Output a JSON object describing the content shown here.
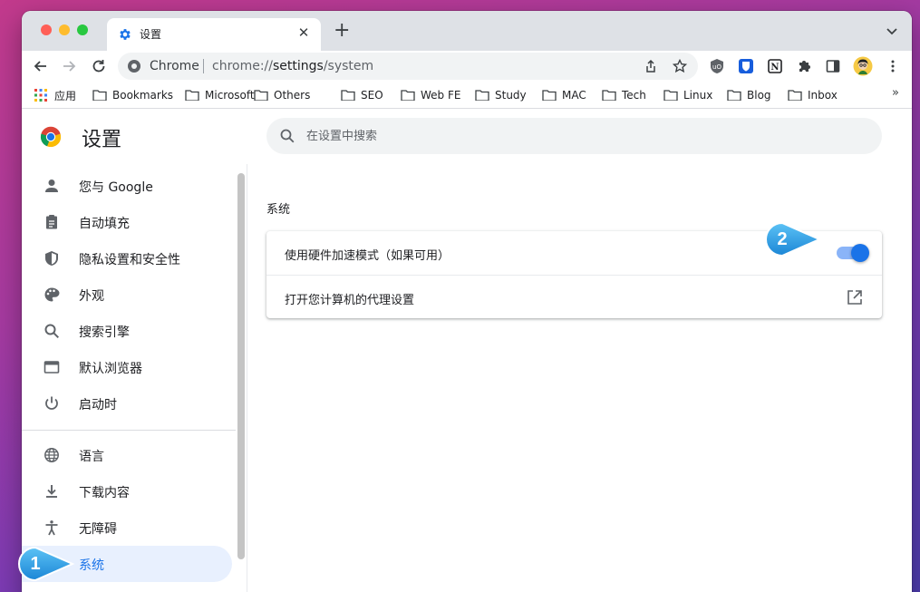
{
  "tab": {
    "title": "设置",
    "close": "✕"
  },
  "toolbar": {
    "omnibox_label": "Chrome",
    "url_prefix": "chrome://",
    "url_bold": "settings",
    "url_suffix": "/system"
  },
  "bookmarks": {
    "apps_label": "应用",
    "items": [
      "Bookmarks",
      "Microsoft",
      "Others",
      "SEO",
      "Web FE",
      "Study",
      "MAC",
      "Tech",
      "Linux",
      "Blog",
      "Inbox"
    ],
    "more": "»"
  },
  "settings": {
    "title": "设置",
    "search_placeholder": "在设置中搜索",
    "sidebar": [
      {
        "label": "您与 Google",
        "icon": "person-icon"
      },
      {
        "label": "自动填充",
        "icon": "clipboard-icon"
      },
      {
        "label": "隐私设置和安全性",
        "icon": "shield-icon"
      },
      {
        "label": "外观",
        "icon": "palette-icon"
      },
      {
        "label": "搜索引擎",
        "icon": "search-icon"
      },
      {
        "label": "默认浏览器",
        "icon": "browser-window-icon"
      },
      {
        "label": "启动时",
        "icon": "power-icon"
      },
      {
        "label": "语言",
        "icon": "globe-icon"
      },
      {
        "label": "下载内容",
        "icon": "download-icon"
      },
      {
        "label": "无障碍",
        "icon": "accessibility-icon"
      },
      {
        "label": "系统",
        "icon": "wrench-icon",
        "active": true
      }
    ],
    "section_title": "系统",
    "rows": [
      {
        "label": "使用硬件加速模式（如果可用）",
        "control": "toggle",
        "on": true
      },
      {
        "label": "打开您计算机的代理设置",
        "control": "external-link"
      }
    ]
  },
  "callouts": [
    "1",
    "2"
  ],
  "colors": {
    "accent": "#1a73e8",
    "active_bg": "#e8f0fe",
    "callout": "#2e9ee6"
  }
}
